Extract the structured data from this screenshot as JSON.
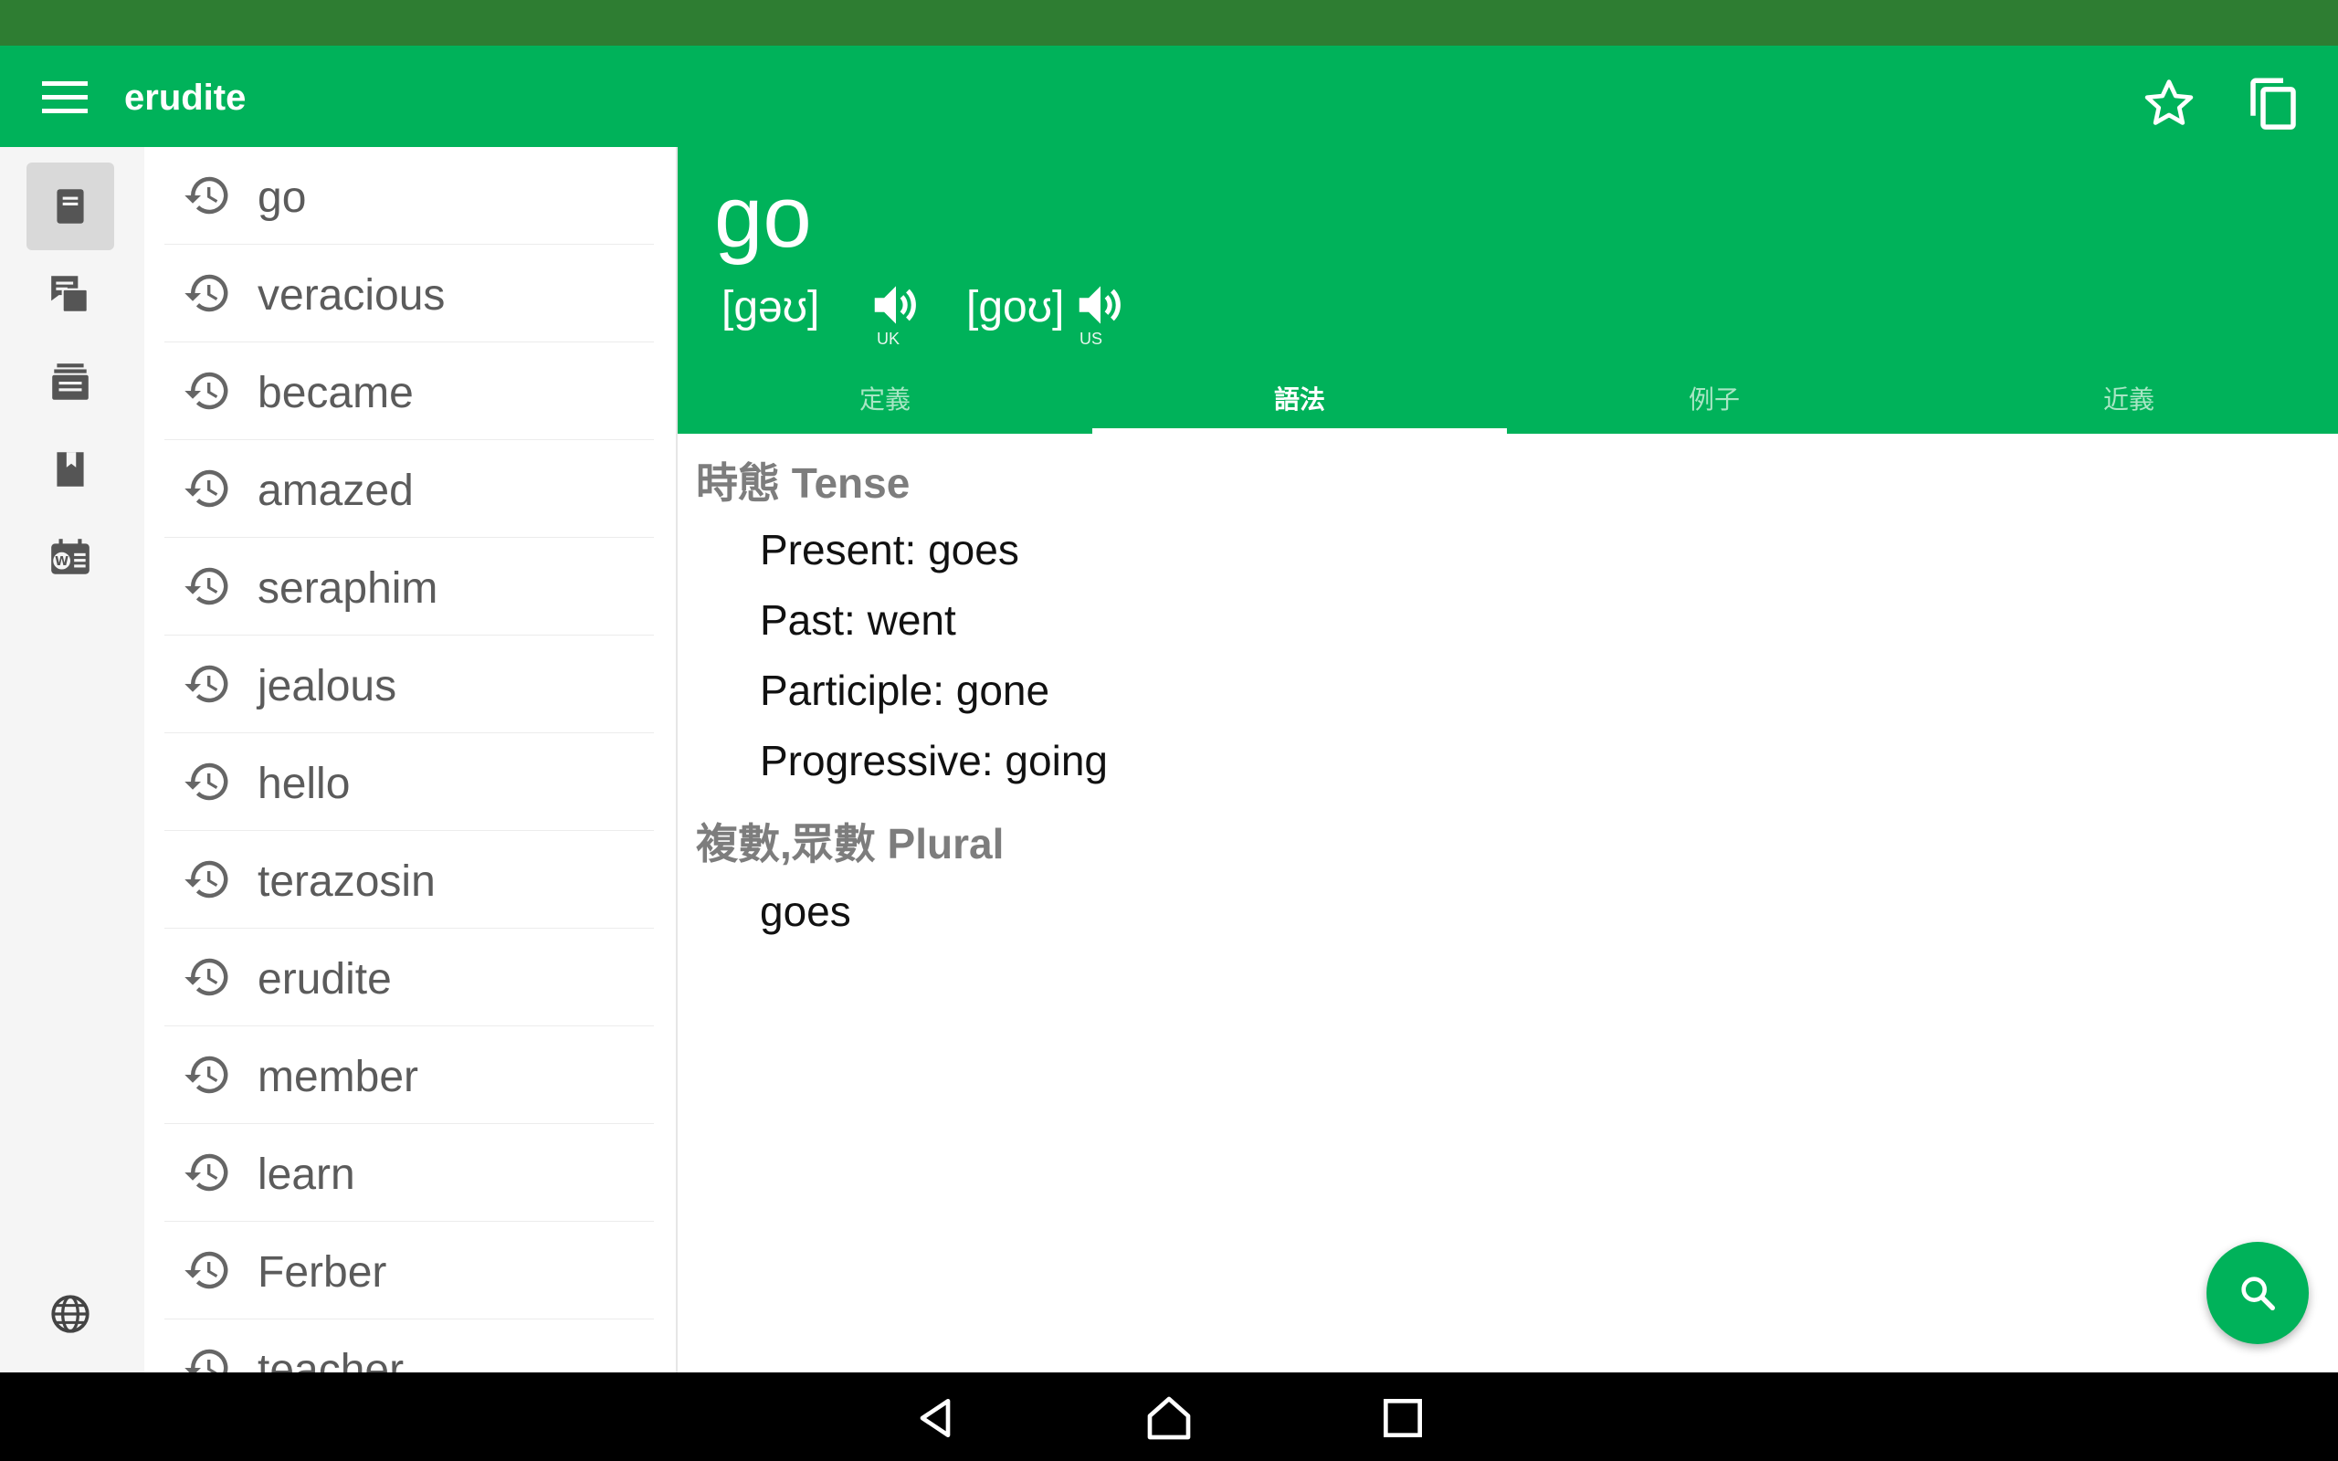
{
  "app": {
    "title": "erudite"
  },
  "header": {
    "menu_icon": "hamburger-icon",
    "actions": [
      "star-icon",
      "copy-icon"
    ]
  },
  "rail": {
    "items": [
      "definition-icon",
      "chat-card-icon",
      "list-icon",
      "bookmark-book-icon",
      "word-calendar-icon"
    ],
    "bottom": "globe-icon",
    "active_index": 0
  },
  "history": {
    "items": [
      "go",
      "veracious",
      "became",
      "amazed",
      "seraphim",
      "jealous",
      "hello",
      "terazosin",
      "erudite",
      "member",
      "learn",
      "Ferber",
      "teacher"
    ]
  },
  "entry": {
    "word": "go",
    "pronunciations": [
      {
        "ipa": "[gəʊ]",
        "tag": "UK"
      },
      {
        "ipa": "[goʊ]",
        "tag": "US"
      }
    ]
  },
  "tabs": [
    {
      "label": "定義",
      "active": false
    },
    {
      "label": "語法",
      "active": true
    },
    {
      "label": "例子",
      "active": false
    },
    {
      "label": "近義",
      "active": false
    }
  ],
  "grammar": {
    "tense_title": "時態 Tense",
    "tense_lines": [
      "Present: goes",
      "Past: went",
      "Participle: gone",
      "Progressive: going"
    ],
    "plural_title": "複數,眾數 Plural",
    "plural_lines": [
      "goes"
    ]
  },
  "colors": {
    "accent": "#00b25a",
    "status_bar": "#2e7d32",
    "nav_bar": "#000000"
  }
}
